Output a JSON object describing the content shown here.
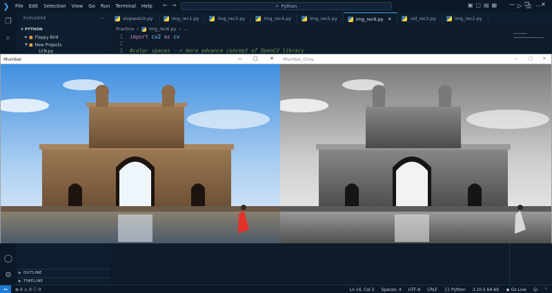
{
  "menu": [
    "File",
    "Edit",
    "Selection",
    "View",
    "Go",
    "Run",
    "Terminal",
    "Help"
  ],
  "search": {
    "text": "Python"
  },
  "sidebar": {
    "title": "EXPLORER",
    "root": "PYTHON",
    "items": [
      {
        "label": "Flappy Bird",
        "open": false
      },
      {
        "label": "New Projects",
        "open": true
      },
      {
        "label": "LCN.py",
        "open": false
      }
    ],
    "outline": "OUTLINE",
    "timeline": "TIMELINE"
  },
  "tabs": [
    {
      "label": "stopwatch.py",
      "active": false
    },
    {
      "label": "img_rec1.py",
      "active": false
    },
    {
      "label": "img_rec3.py",
      "active": false
    },
    {
      "label": "img_rec4.py",
      "active": false
    },
    {
      "label": "img_rec5.py",
      "active": false
    },
    {
      "label": "img_rec6.py",
      "active": true
    },
    {
      "label": "vid_rec1.py",
      "active": false
    },
    {
      "label": "img_rec2.py",
      "active": false
    }
  ],
  "breadcrumb": {
    "folder": "Practice",
    "file": "img_rec6.py",
    "more": "..."
  },
  "code": {
    "line1": {
      "num": "1",
      "kw1": "import",
      "mod": "cv2",
      "kw2": "as",
      "alias": "cv"
    },
    "line2": {
      "num": "2"
    },
    "line3": {
      "num": "3",
      "comment": "#color spaces --> more advance concept of OpenCV library"
    }
  },
  "windows": {
    "color": {
      "title": "Mumbai"
    },
    "gray": {
      "title": "Mumbai_Gray"
    }
  },
  "status": {
    "errors": "0",
    "warnings": "0",
    "info": "0",
    "position": "Ln 14, Col 2",
    "spaces": "Spaces: 4",
    "encoding": "UTF-8",
    "eol": "CRLF",
    "language": "Python",
    "interpreter": "3.10.5 64-bit",
    "golive": "Go Live"
  },
  "colors": {
    "accent": "#3ea6ff",
    "background": "#0d1b2a",
    "statusbar_remote": "#1e7ad6"
  },
  "icons": [
    "vscode-logo-icon",
    "explorer-icon",
    "search-icon",
    "account-icon",
    "settings-gear-icon",
    "python-file-icon",
    "folder-icon",
    "run-icon",
    "close-icon"
  ]
}
